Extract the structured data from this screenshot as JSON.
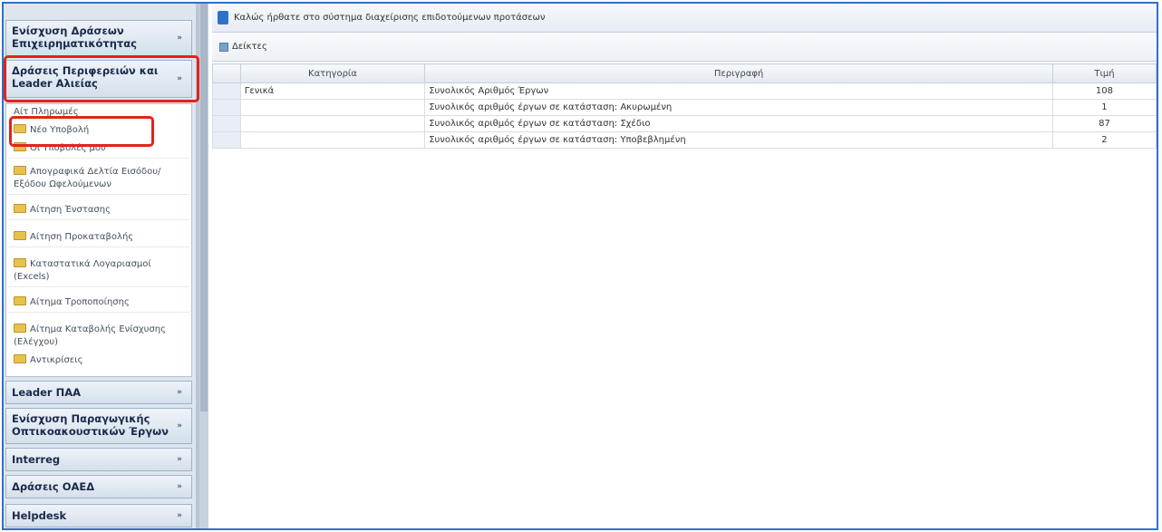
{
  "sidebar": {
    "sections": {
      "s1": "Ενίσχυση Δράσεων Επιχειρηματικότητας",
      "s2": "Δράσεις Περιφερειών και Leader Αλιείας",
      "s3": "Leader ΠΑΑ",
      "s4": "Ενίσχυση Παραγωγικής Οπτικοακουστικών Έργων",
      "s5": "Interreg",
      "s6": "Δράσεις ΟΑΕΔ",
      "s7": "Helpdesk"
    },
    "items": [
      "Αίτ Πληρωμές",
      "Νέο Υποβολή",
      "Οι Υποβολές μου",
      "Απογραφικά Δελτία Εισόδου/ Εξόδου Ωφελούμενων",
      "Αίτηση Ένστασης",
      "Αίτηση Προκαταβολής",
      "Καταστατικά Λογαριασμοί (Excels)",
      "Αίτημα Τροποποίησης",
      "Αίτημα Καταβολής Ενίσχυσης (Ελέγχου)",
      "Αντικρίσεις"
    ]
  },
  "main": {
    "title": "Καλώς ήρθατε στο σύστημα διαχείρισης επιδοτούμενων προτάσεων",
    "toolbar_label": "Δείκτες",
    "columns": {
      "category": "Κατηγορία",
      "description": "Περιγραφή",
      "value": "Τιμή"
    },
    "rows": [
      {
        "category": "Γενικά",
        "description": "Συνολικός Αριθμός Έργων",
        "value": "108"
      },
      {
        "category": "",
        "description": "Συνολικός αριθμός έργων σε κατάσταση: Ακυρωμένη",
        "value": "1"
      },
      {
        "category": "",
        "description": "Συνολικός αριθμός έργων σε κατάσταση: Σχέδιο",
        "value": "87"
      },
      {
        "category": "",
        "description": "Συνολικός αριθμός έργων σε κατάσταση: Υποβεβλημένη",
        "value": "2"
      }
    ]
  },
  "colors": {
    "highlight": "#e2231a",
    "frame": "#2f6fcf"
  }
}
